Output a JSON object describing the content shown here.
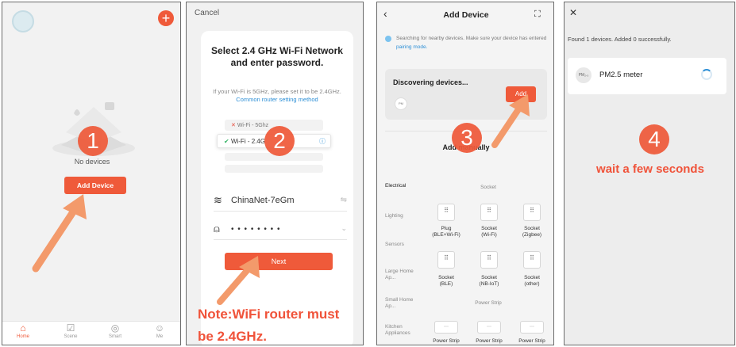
{
  "steps": [
    "1",
    "2",
    "3",
    "4"
  ],
  "colors": {
    "accent": "#ef5a3a",
    "link": "#2d8fd6",
    "caption_red": "#f0533a"
  },
  "panel1": {
    "empty_text": "No devices",
    "add_device_button": "Add Device",
    "tabs": [
      {
        "label": "Home",
        "icon": "home-icon"
      },
      {
        "label": "Scene",
        "icon": "scene-icon"
      },
      {
        "label": "Smart",
        "icon": "smart-icon"
      },
      {
        "label": "Me",
        "icon": "me-icon"
      }
    ]
  },
  "panel2": {
    "cancel": "Cancel",
    "title": "Select 2.4 GHz Wi-Fi Network and enter password.",
    "hint": "If your Wi-Fi is 5GHz, please set it to be 2.4GHz.",
    "hint_link": "Common router setting method",
    "wifi_bad": "Wi-Fi - 5Ghz",
    "wifi_good": "Wi-Fi - 2.4G",
    "network_name": "ChinaNet-7eGm",
    "password_mask": "• • • • • • • •",
    "next_button": "Next",
    "note_line1": "Note:WiFi router must",
    "note_line2": "be 2.4GHz."
  },
  "panel3": {
    "title": "Add Device",
    "searching_text": "Searching for nearby devices. Make sure your device has entered",
    "searching_link": "pairing mode.",
    "discovering": "Discovering devices...",
    "device_badge": "PM",
    "add_button": "Add",
    "add_manually": "Add manually",
    "categories": [
      "Electrical",
      "Lighting",
      "Sensors",
      "Large Home Ap...",
      "Small Home Ap...",
      "Kitchen Appliances"
    ],
    "section_socket": "Socket",
    "section_power_strip": "Power Strip",
    "items_row1": [
      "Plug\n(BLE+Wi-Fi)",
      "Socket\n(Wi-Fi)",
      "Socket\n(Zigbee)"
    ],
    "items_row2": [
      "Socket\n(BLE)",
      "Socket\n(NB-IoT)",
      "Socket\n(other)"
    ],
    "items_row3": [
      "Power Strip",
      "Power Strip",
      "Power Strip"
    ]
  },
  "panel4": {
    "close": "✕",
    "found_text": "Found 1 devices. Added 0 successfully.",
    "device_badge": "PM₂.₅",
    "device_name": "PM2.5 meter",
    "wait_text": "wait a few seconds"
  }
}
